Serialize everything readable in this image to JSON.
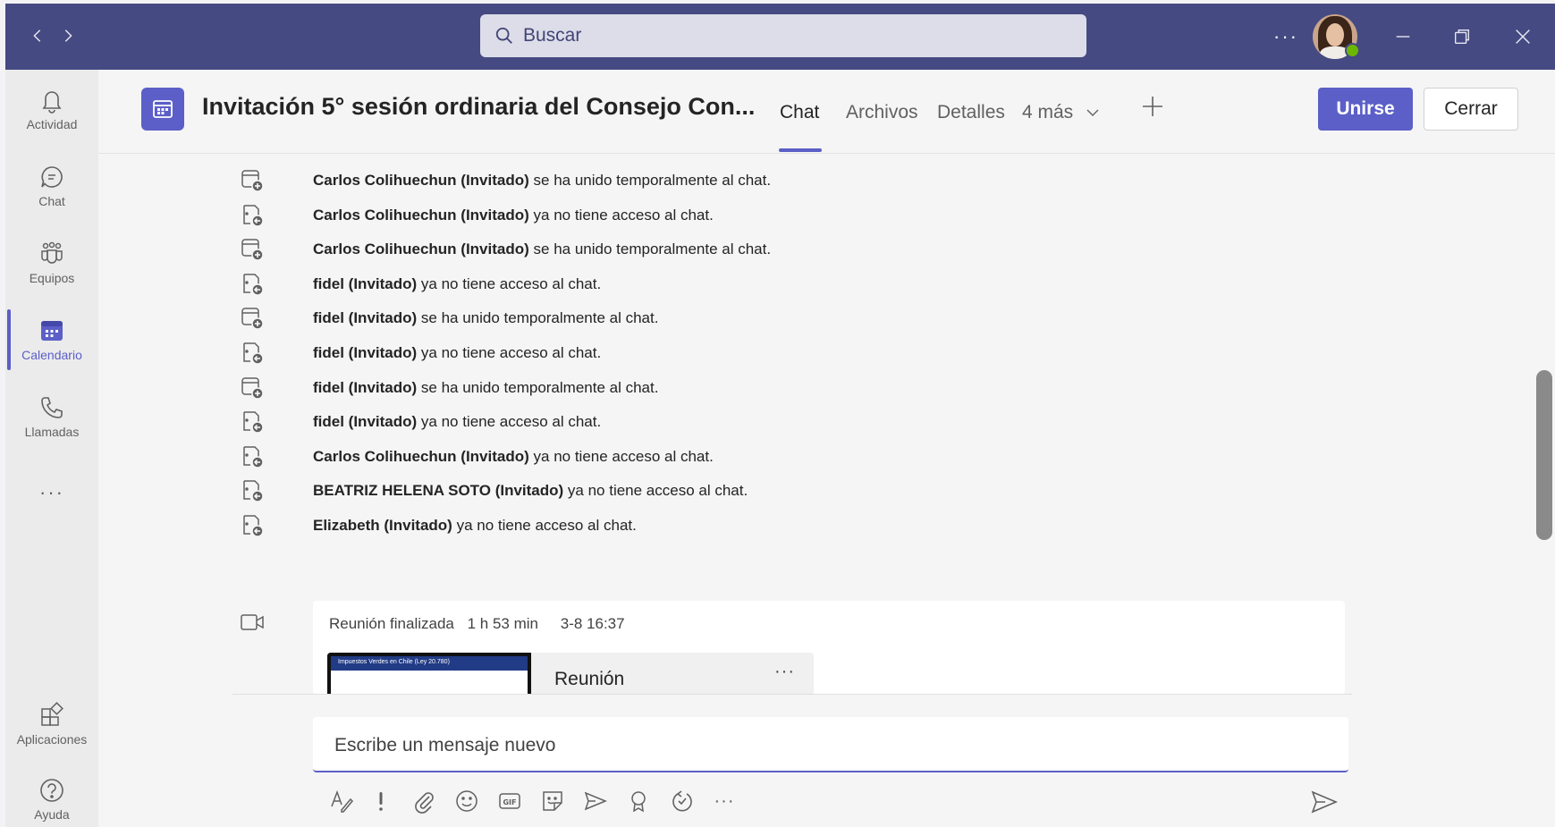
{
  "search": {
    "placeholder": "Buscar"
  },
  "titlebar": {
    "more": "···"
  },
  "rail": {
    "items": [
      {
        "label": "Actividad"
      },
      {
        "label": "Chat"
      },
      {
        "label": "Equipos"
      },
      {
        "label": "Calendario"
      },
      {
        "label": "Llamadas"
      }
    ],
    "more": "···",
    "apps": "Aplicaciones",
    "help": "Ayuda"
  },
  "header": {
    "title": "Invitación 5° sesión ordinaria del Consejo Con...",
    "tabs": [
      "Chat",
      "Archivos",
      "Detalles",
      "4 más"
    ],
    "join": "Unirse",
    "close": "Cerrar"
  },
  "events": [
    {
      "name": "Carlos Colihuechun (Invitado)",
      "action": " se ha unido temporalmente al chat.",
      "type": "join"
    },
    {
      "name": "Carlos Colihuechun (Invitado)",
      "action": " ya no tiene acceso al chat.",
      "type": "leave"
    },
    {
      "name": "Carlos Colihuechun (Invitado)",
      "action": " se ha unido temporalmente al chat.",
      "type": "join"
    },
    {
      "name": "fidel (Invitado)",
      "action": " ya no tiene acceso al chat.",
      "type": "leave"
    },
    {
      "name": "fidel (Invitado)",
      "action": " se ha unido temporalmente al chat.",
      "type": "join"
    },
    {
      "name": "fidel (Invitado)",
      "action": " ya no tiene acceso al chat.",
      "type": "leave"
    },
    {
      "name": "fidel (Invitado)",
      "action": " se ha unido temporalmente al chat.",
      "type": "join"
    },
    {
      "name": "fidel (Invitado)",
      "action": " ya no tiene acceso al chat.",
      "type": "leave"
    },
    {
      "name": "Carlos Colihuechun (Invitado)",
      "action": " ya no tiene acceso al chat.",
      "type": "leave"
    },
    {
      "name": "BEATRIZ HELENA SOTO (Invitado)",
      "action": " ya no tiene acceso al chat.",
      "type": "leave"
    },
    {
      "name": "Elizabeth (Invitado)",
      "action": " ya no tiene acceso al chat.",
      "type": "leave"
    }
  ],
  "meeting": {
    "status": "Reunión finalizada",
    "duration": "1 h 53 min",
    "date": "3-8 16:37",
    "recording_title": "Reunión",
    "recording_more": "···",
    "thumb_text": "Impuestos Verdes en Chile (Ley 20.780)"
  },
  "compose": {
    "placeholder": "Escribe un mensaje nuevo",
    "more": "···"
  }
}
